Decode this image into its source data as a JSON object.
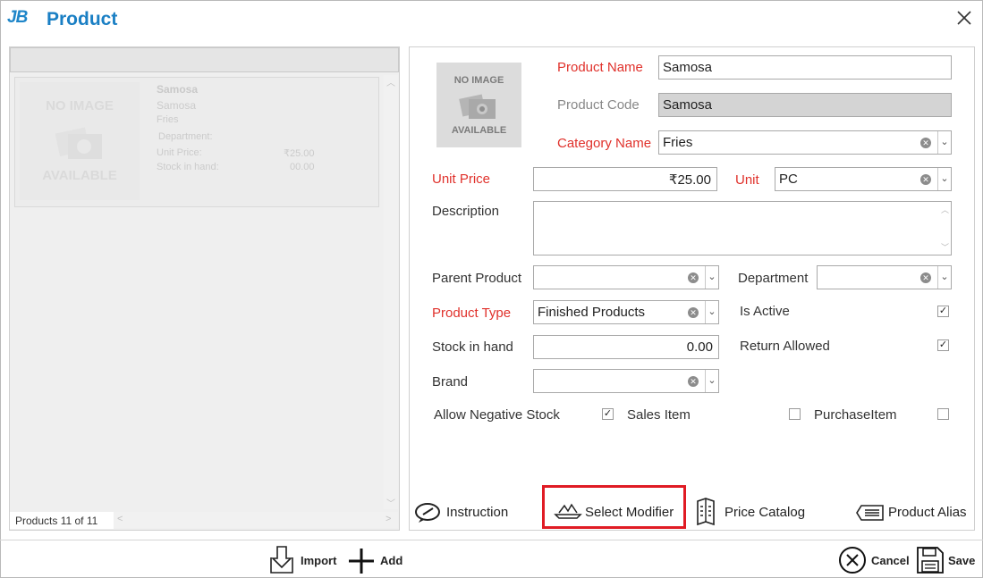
{
  "window": {
    "logo": "JB",
    "title": "Product"
  },
  "left_panel": {
    "card": {
      "image_top": "NO IMAGE",
      "image_bottom": "AVAILABLE",
      "name": "Samosa",
      "code": "Samosa",
      "category": "Fries",
      "department_label": "Department:",
      "unit_price_label": "Unit Price:",
      "unit_price_value": "₹25.00",
      "stock_label": "Stock in hand:",
      "stock_value": "00.00"
    },
    "count": "Products 11 of 11"
  },
  "form": {
    "image_top": "NO IMAGE",
    "image_bottom": "AVAILABLE",
    "product_name": {
      "label": "Product Name",
      "value": "Samosa"
    },
    "product_code": {
      "label": "Product Code",
      "value": "Samosa"
    },
    "category_name": {
      "label": "Category Name",
      "value": "Fries"
    },
    "unit_price": {
      "label": "Unit Price",
      "value": "₹25.00"
    },
    "unit": {
      "label": "Unit",
      "value": "PC"
    },
    "description": {
      "label": "Description",
      "value": ""
    },
    "parent_product": {
      "label": "Parent Product",
      "value": ""
    },
    "department": {
      "label": "Department",
      "value": ""
    },
    "product_type": {
      "label": "Product Type",
      "value": "Finished Products"
    },
    "is_active": {
      "label": "Is Active",
      "checked": true
    },
    "stock_in_hand": {
      "label": "Stock in hand",
      "value": "0.00"
    },
    "return_allowed": {
      "label": "Return Allowed",
      "checked": true
    },
    "brand": {
      "label": "Brand",
      "value": ""
    },
    "allow_negative_stock": {
      "label": "Allow Negative Stock",
      "checked": true
    },
    "sales_item": {
      "label": "Sales Item",
      "checked": false
    },
    "purchase_item": {
      "label": "PurchaseItem",
      "checked": false
    }
  },
  "tabs": {
    "instruction": "Instruction",
    "select_modifier": "Select Modifier",
    "price_catalog": "Price Catalog",
    "product_alias": "Product Alias"
  },
  "footer": {
    "import": "Import",
    "add": "Add",
    "cancel": "Cancel",
    "save": "Save"
  },
  "colors": {
    "accent": "#1a7fc4",
    "required": "#e0312b",
    "highlight": "#e01b24"
  }
}
